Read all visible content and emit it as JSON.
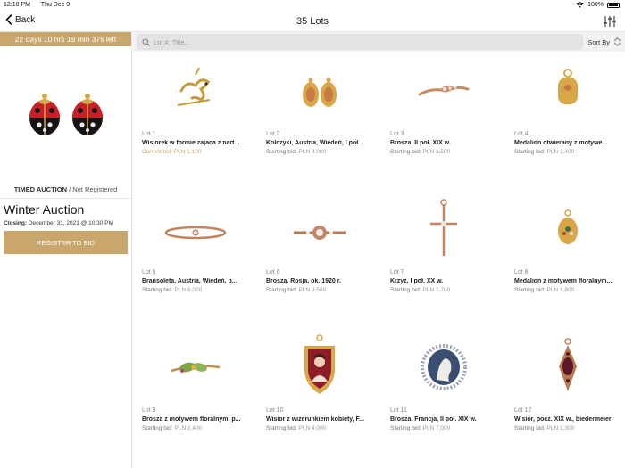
{
  "status": {
    "time": "12:10 PM",
    "date": "Thu Dec 9",
    "battery": "100%"
  },
  "nav": {
    "back_label": "Back",
    "title": "35 Lots"
  },
  "sidebar": {
    "countdown": "22 days 10 hrs 19 min 37s left",
    "auction_type": "TIMED AUCTION",
    "registration_status": " / Not Registered",
    "auction_title": "Winter Auction",
    "closing_label": "Closing:",
    "closing_value": " December 31, 2021 @ 10:30 PM",
    "register_button": "REGISTER TO BID"
  },
  "search": {
    "placeholder": "Lot #, Title...",
    "sort_label": "Sort By"
  },
  "colors": {
    "accent": "#c9a66b"
  },
  "lots": [
    {
      "lot": "Lot 1",
      "title": "Wisiorek w formie zajaca z nart...",
      "bid_label": "Current bid:",
      "bid_value": "PLN 1,100",
      "icon": "hare-pendant-icon"
    },
    {
      "lot": "Lot 2",
      "title": "Kolczyki, Austria, Wiedeń, I poł...",
      "bid_label": "Starting bid:",
      "bid_value": "PLN 4,000",
      "icon": "earrings-icon"
    },
    {
      "lot": "Lot 3",
      "title": "Brosza, II poł. XIX w.",
      "bid_label": "Starting bid:",
      "bid_value": "PLN 3,500",
      "icon": "brooch-icon"
    },
    {
      "lot": "Lot 4",
      "title": "Medalion otwierany z motywe...",
      "bid_label": "Starting bid:",
      "bid_value": "PLN 2,400",
      "icon": "locket-icon"
    },
    {
      "lot": "Lot 5",
      "title": "Bransoleta, Austria, Wiedeń, p...",
      "bid_label": "Starting bid:",
      "bid_value": "PLN 6,000",
      "icon": "bracelet-icon"
    },
    {
      "lot": "Lot 6",
      "title": "Brosza, Rosja, ok. 1920 r.",
      "bid_label": "Starting bid:",
      "bid_value": "PLN 3,500",
      "icon": "bar-brooch-icon"
    },
    {
      "lot": "Lot 7",
      "title": "Krzyż, I poł. XX w.",
      "bid_label": "Starting bid:",
      "bid_value": "PLN 1,700",
      "icon": "cross-icon"
    },
    {
      "lot": "Lot 8",
      "title": "Medalion z motywem floralnym...",
      "bid_label": "Starting bid:",
      "bid_value": "PLN 1,800",
      "icon": "floral-locket-icon"
    },
    {
      "lot": "Lot 9",
      "title": "Brosza z motywem floralnym, p...",
      "bid_label": "Starting bid:",
      "bid_value": "PLN 2,400",
      "icon": "floral-brooch-icon"
    },
    {
      "lot": "Lot 10",
      "title": "Wisior z wizerunkiem kobiety, F...",
      "bid_label": "Starting bid:",
      "bid_value": "PLN 4,000",
      "icon": "portrait-pendant-icon"
    },
    {
      "lot": "Lot 11",
      "title": "Brosza, Francja, II poł. XIX w.",
      "bid_label": "Starting bid:",
      "bid_value": "PLN 7,000",
      "icon": "cameo-brooch-icon"
    },
    {
      "lot": "Lot 12",
      "title": "Wisior, pocz. XIX w., biedermeier",
      "bid_label": "Starting bid:",
      "bid_value": "PLN 1,300",
      "icon": "garnet-pendant-icon"
    }
  ]
}
